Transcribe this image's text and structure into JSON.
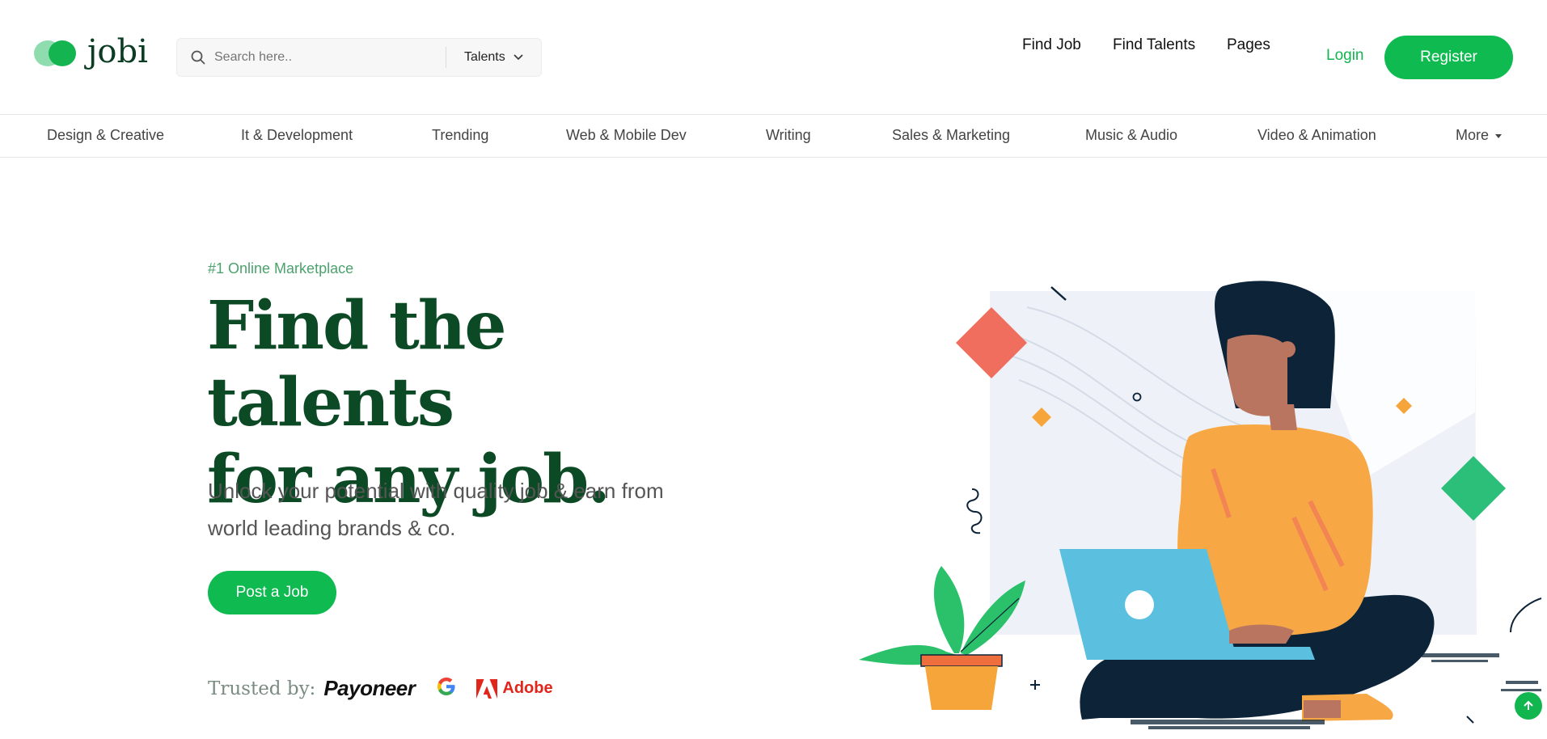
{
  "brand": {
    "name": "jobi"
  },
  "search": {
    "placeholder": "Search here..",
    "category": "Talents"
  },
  "nav": {
    "find_job": "Find Job",
    "find_talents": "Find Talents",
    "pages": "Pages",
    "login": "Login",
    "register": "Register"
  },
  "categories": [
    "Design & Creative",
    "It & Development",
    "Trending",
    "Web & Mobile Dev",
    "Writing",
    "Sales & Marketing",
    "Music & Audio",
    "Video & Animation",
    "More"
  ],
  "hero": {
    "eyebrow": "#1 Online Marketplace",
    "headline": "Find the talents\nfor any job.",
    "subtext": "Unlock your potential with quality job & earn from world leading brands & co.",
    "cta": "Post a Job"
  },
  "trusted": {
    "label": "Trusted by:",
    "brands": [
      "Payoneer",
      "Google",
      "Adobe"
    ]
  },
  "icons": {
    "search": "search-icon",
    "dropdown": "chevron-down-icon",
    "scroll_top": "arrow-up-icon"
  },
  "colors": {
    "brand_green": "#0fba50",
    "headline_green": "#0b4a24",
    "eyebrow_green": "#4aa36c"
  }
}
